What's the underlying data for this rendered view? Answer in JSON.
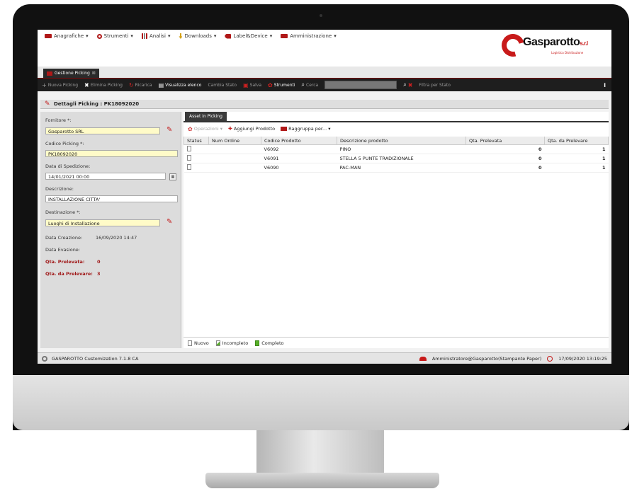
{
  "menu": {
    "items": [
      {
        "label": "Anagrafiche",
        "icon": "folder-icon"
      },
      {
        "label": "Strumenti",
        "icon": "gear-icon"
      },
      {
        "label": "Analisi",
        "icon": "chart-icon"
      },
      {
        "label": "Downloads",
        "icon": "download-icon"
      },
      {
        "label": "Label&Device",
        "icon": "label-icon"
      },
      {
        "label": "Amministrazione",
        "icon": "admin-icon"
      }
    ],
    "caret": "▾"
  },
  "logo": {
    "name": "Gasparotto",
    "suffix": "s.r.l",
    "tagline": "Logistica Distribuzione"
  },
  "tab": {
    "label": "Gestione Picking",
    "close": "⊠"
  },
  "toolbar": {
    "new": "Nuova Picking",
    "delete": "Elimina Picking",
    "reload": "Ricarica",
    "view_list": "Visualizza elenco",
    "change_state": "Cambia Stato",
    "save": "Salva",
    "tools": "Strumenti",
    "search": "Cerca",
    "filter": "Filtra per Stato",
    "info": "i"
  },
  "details": {
    "title": "Dettagli Picking : PK18092020"
  },
  "form": {
    "fornitore_label": "Fornitore *:",
    "fornitore_value": "Gasparotto SRL",
    "codice_label": "Codice Picking *:",
    "codice_value": "PK18092020",
    "data_sped_label": "Data di Spedizione:",
    "data_sped_value": "14/01/2021 00:00",
    "descrizione_label": "Descrizione:",
    "descrizione_value": "INSTALLAZIONE CITTA'",
    "destinazione_label": "Destinazione *:",
    "destinazione_value": "Luoghi di Installazione",
    "data_creazione_label": "Data Creazione:",
    "data_creazione_value": "16/09/2020 14:47",
    "data_evasione_label": "Data Evasione:",
    "qta_prelevata_label": "Qta. Prelevata:",
    "qta_prelevata_value": "0",
    "qta_da_prelevare_label": "Qta. da Prelevare:",
    "qta_da_prelevare_value": "3"
  },
  "assets": {
    "tab": "Asset in Picking",
    "toolbar": {
      "operations": "Operazioni",
      "add": "Aggiungi Prodotto",
      "group": "Raggruppa per..."
    },
    "columns": [
      "Status",
      "Num Ordine",
      "Codice Prodotto",
      "Descrizione prodotto",
      "Qta. Prelevata",
      "Qta. da Prelevare"
    ],
    "rows": [
      {
        "num_ordine": "",
        "codice": "V6092",
        "descrizione": "PINO",
        "prelevata": "0",
        "da_prelevare": "1"
      },
      {
        "num_ordine": "",
        "codice": "V6091",
        "descrizione": "STELLA 5 PUNTE TRADIZIONALE",
        "prelevata": "0",
        "da_prelevare": "1"
      },
      {
        "num_ordine": "",
        "codice": "V6090",
        "descrizione": "PAC-MAN",
        "prelevata": "0",
        "da_prelevare": "1"
      }
    ],
    "legend": {
      "new": "Nuovo",
      "partial": "Incompleto",
      "complete": "Completo"
    }
  },
  "status": {
    "app": "GASPAROTTO Customization 7.1.8 CA",
    "user": "Amministratore@Gasparotto(Stampante Paper)",
    "datetime": "17/09/2020 13:19:25"
  }
}
